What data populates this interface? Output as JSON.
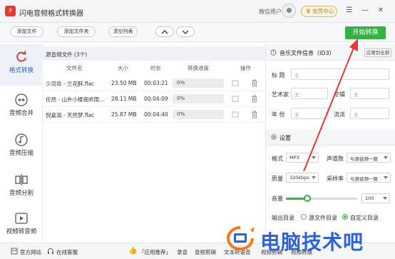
{
  "window": {
    "title": "闪电音频格式转换器",
    "user_label": "微信用户",
    "vip_label": "会员中心"
  },
  "toolbar": {
    "add_file": "添加文件",
    "add_folder": "添加文件夹",
    "clear_list": "清空列表",
    "start_convert": "开始转换"
  },
  "sidebar": {
    "items": [
      {
        "label": "格式转换",
        "icon": "refresh-icon"
      },
      {
        "label": "音频合并",
        "icon": "merge-icon"
      },
      {
        "label": "音频压缩",
        "icon": "music-note-icon"
      },
      {
        "label": "音频分割",
        "icon": "split-icon"
      },
      {
        "label": "视频转音频",
        "icon": "play-icon"
      }
    ]
  },
  "file_list": {
    "header": "源音频文件 (3个)",
    "columns": [
      "文件名",
      "大小",
      "时长",
      "转换进度",
      "操作"
    ],
    "rows": [
      {
        "name": "少司命 - 兰花醉.flac",
        "size": "23.50 MB",
        "duration": "00:03:21",
        "progress": "0%"
      },
      {
        "name": "任然 - 山外小楼夜听雨...",
        "size": "28.11 MB",
        "duration": "00:04:09",
        "progress": "0%"
      },
      {
        "name": "倪嘉润 - 天然梦.flac",
        "size": "25.87 MB",
        "duration": "00:04:40",
        "progress": "0%"
      }
    ]
  },
  "meta": {
    "title": "音乐文件信息（ID3）",
    "apply_all": "应用到全部",
    "placeholder": "无",
    "fields": {
      "title": "标   题",
      "artist": "艺术家",
      "album": "专辑",
      "year": "年   份",
      "genre": "流派"
    }
  },
  "settings": {
    "title": "设置",
    "format_label": "格式",
    "format_value": "MP3",
    "channels_label": "声道数",
    "channels_value": "与源音频一致",
    "quality_label": "质量",
    "quality_value": "320kbps",
    "sample_label": "采样率",
    "sample_value": "与源音频一致",
    "volume_label": "音量",
    "volume_value": "100",
    "volume_fraction": 0.3,
    "output_label": "输出目录",
    "output_source": "源文件目录",
    "output_custom": "自定义目录"
  },
  "bottom": {
    "website": "官方网站",
    "service": "在线客服",
    "recommend": "「应用推荐」",
    "items": [
      "录音",
      "音频剪辑",
      "文本转语音",
      "视频剪辑",
      "视频转换"
    ]
  },
  "watermark": {
    "text": "电脑技术吧"
  },
  "colors": {
    "accent": "#2f61c9",
    "start": "#35b243",
    "arrow": "#e53935"
  }
}
